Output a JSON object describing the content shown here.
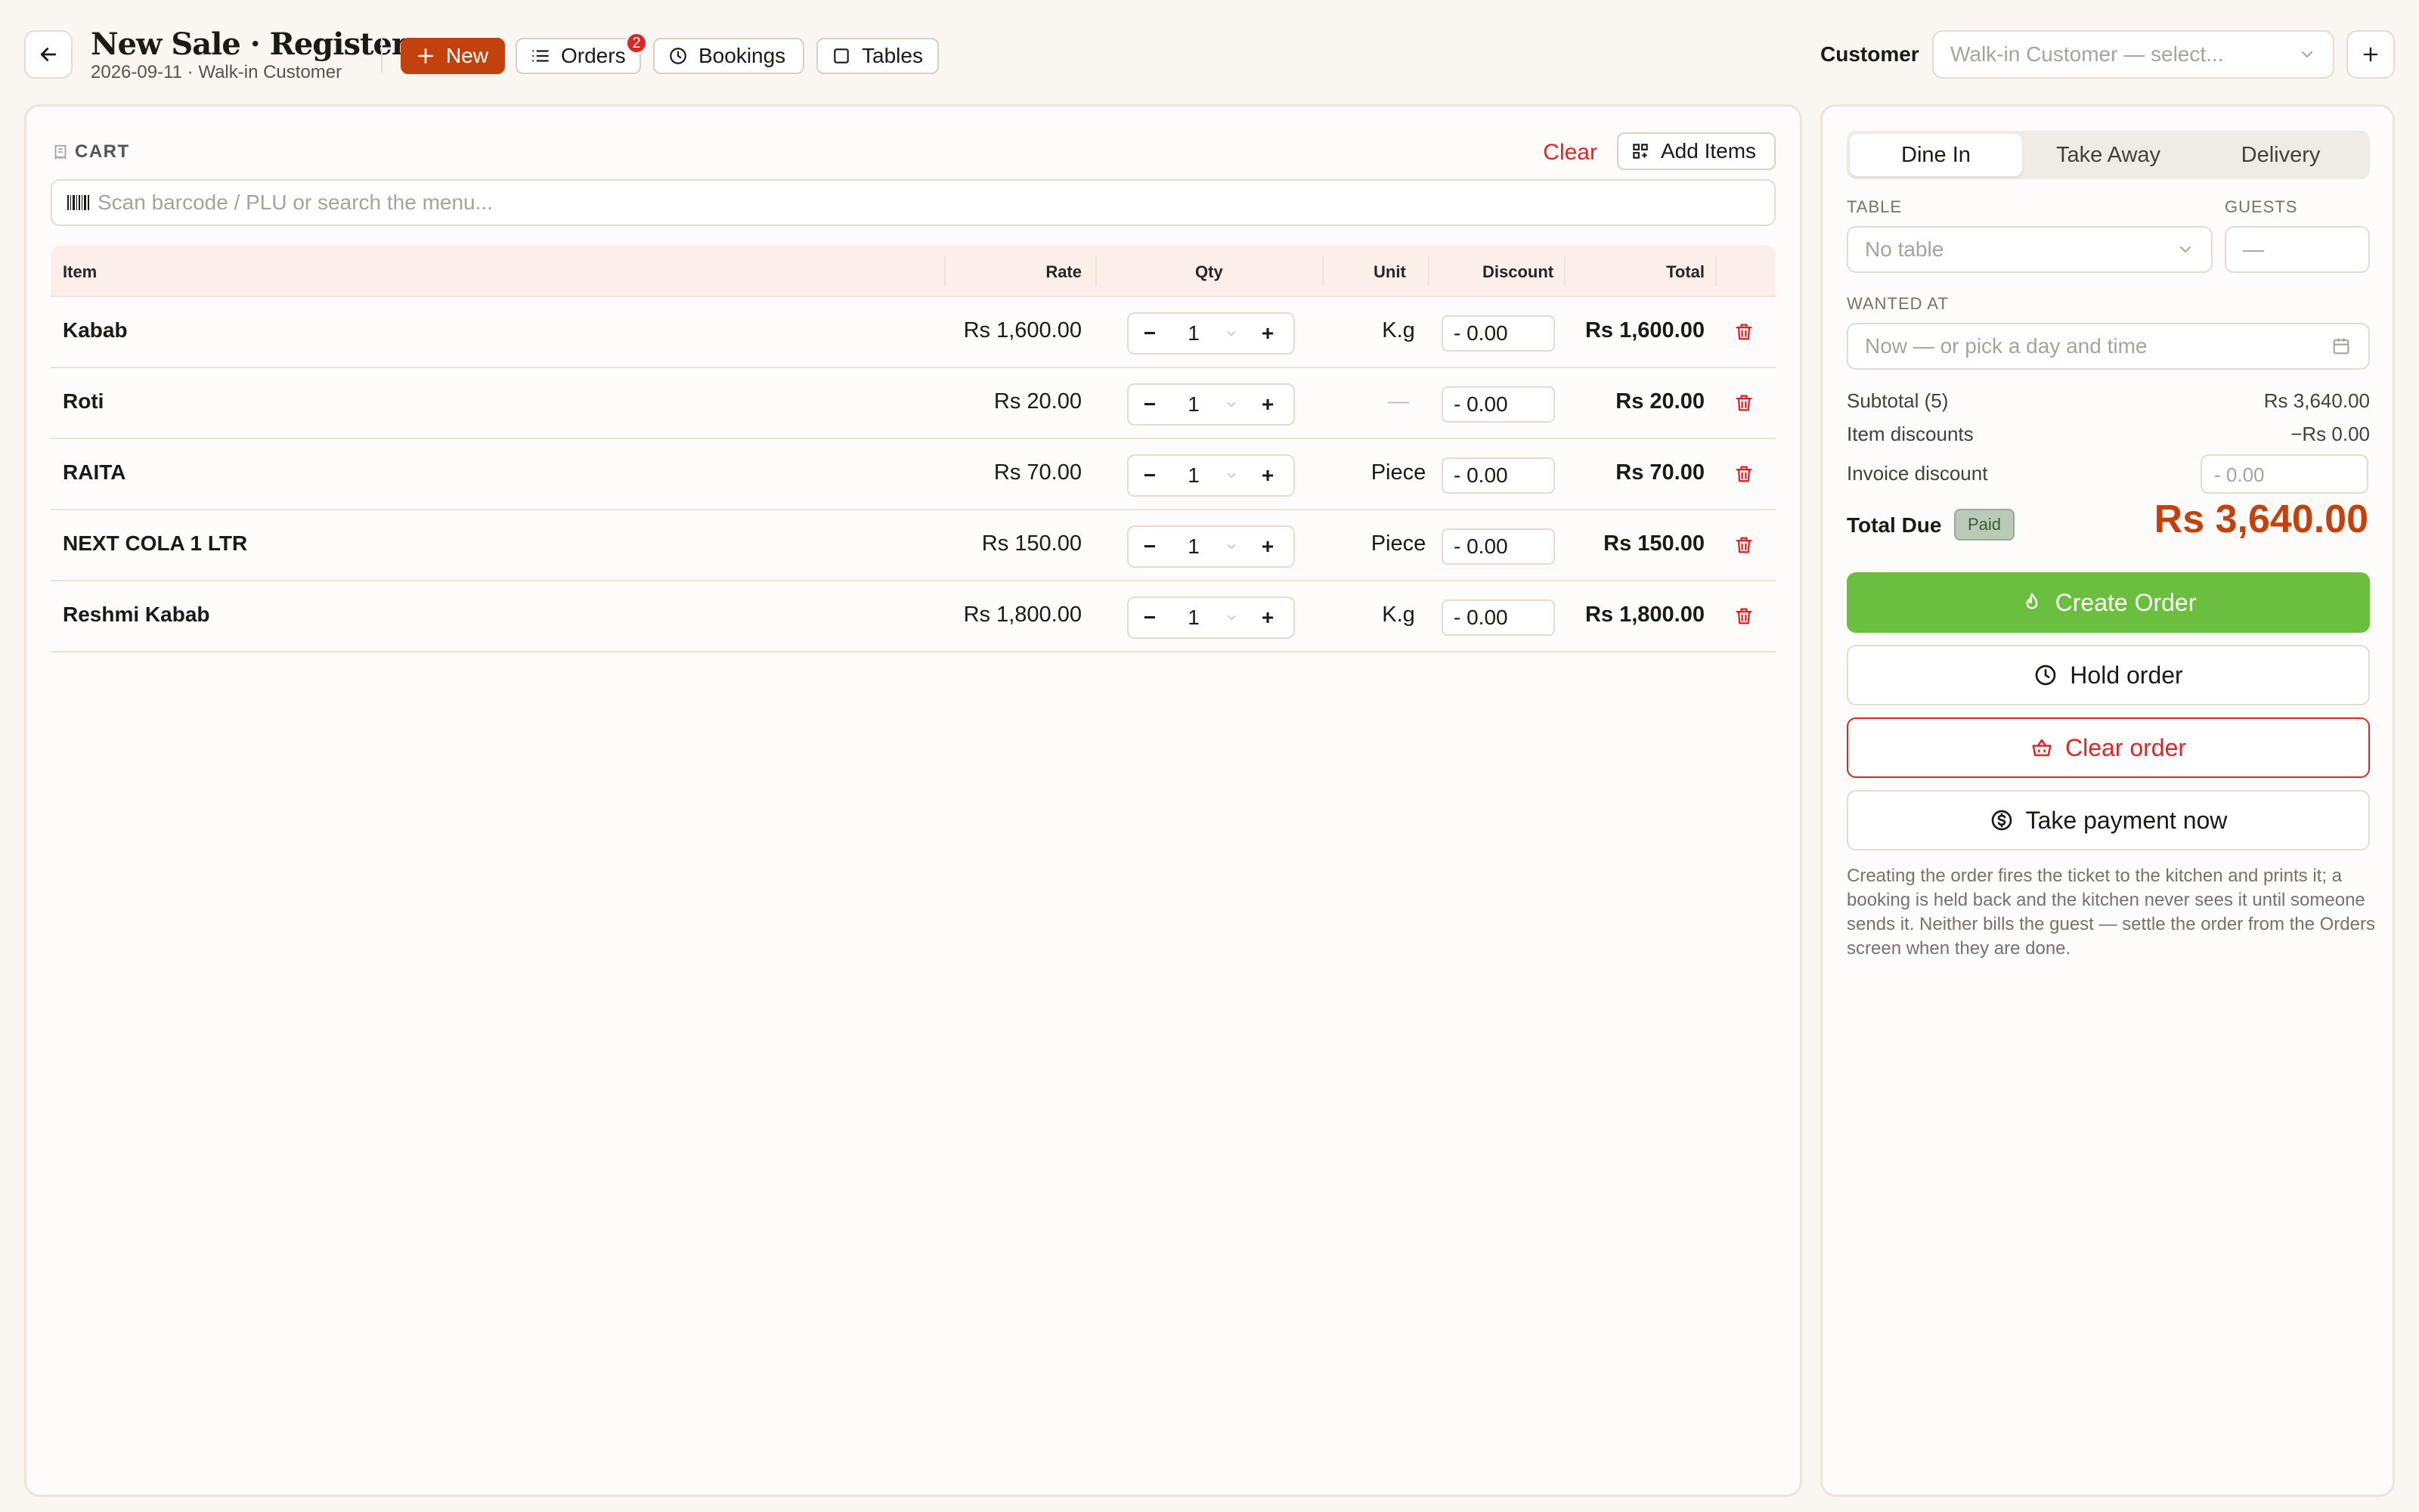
{
  "header": {
    "title": "New Sale · Register",
    "subtitle": "2026-09-11 · Walk-in Customer",
    "buttons": {
      "new": "New",
      "orders": "Orders",
      "orders_badge": "2",
      "bookings": "Bookings",
      "tables": "Tables"
    },
    "customer_label": "Customer",
    "customer_placeholder": "Walk-in Customer — select..."
  },
  "cart": {
    "title": "CART",
    "clear_label": "Clear",
    "add_items_label": "Add Items",
    "search_placeholder": "Scan barcode / PLU or search the menu...",
    "columns": [
      "Item",
      "Rate",
      "Qty",
      "Unit",
      "Discount",
      "Total"
    ],
    "rows": [
      {
        "item": "Kabab",
        "rate": "Rs 1,600.00",
        "qty": "1",
        "unit": "K.g",
        "discount": "- 0.00",
        "total": "Rs 1,600.00"
      },
      {
        "item": "Roti",
        "rate": "Rs 20.00",
        "qty": "1",
        "unit": "—",
        "discount": "- 0.00",
        "total": "Rs 20.00"
      },
      {
        "item": "RAITA",
        "rate": "Rs 70.00",
        "qty": "1",
        "unit": "Piece",
        "discount": "- 0.00",
        "total": "Rs 70.00"
      },
      {
        "item": "NEXT COLA 1 LTR",
        "rate": "Rs 150.00",
        "qty": "1",
        "unit": "Piece",
        "discount": "- 0.00",
        "total": "Rs 150.00"
      },
      {
        "item": "Reshmi Kabab",
        "rate": "Rs 1,800.00",
        "qty": "1",
        "unit": "K.g",
        "discount": "- 0.00",
        "total": "Rs 1,800.00"
      }
    ]
  },
  "order": {
    "tabs": [
      "Dine In",
      "Take Away",
      "Delivery"
    ],
    "active_tab": "Dine In",
    "table_label": "TABLE",
    "table_placeholder": "No table",
    "guests_label": "GUESTS",
    "guests_placeholder": "—",
    "wanted_label": "WANTED AT",
    "wanted_placeholder": "Now — or pick a day and time",
    "subtotal_label": "Subtotal (5)",
    "subtotal_value": "Rs 3,640.00",
    "item_discounts_label": "Item discounts",
    "item_discounts_value": "−Rs 0.00",
    "invoice_discount_label": "Invoice discount",
    "invoice_discount_value": "- 0.00",
    "total_label": "Total Due",
    "paid_badge": "Paid",
    "total_value": "Rs 3,640.00",
    "create_label": "Create Order",
    "hold_label": "Hold order",
    "clear_label": "Clear order",
    "pay_label": "Take payment now",
    "help_text": "Creating the order fires the ticket to the kitchen and prints it; a booking is held back and the kitchen never sees it until someone sends it. Neither bills the guest — settle the order from the Orders screen when they are done."
  },
  "colors": {
    "accent": "#c2410c",
    "create": "#6abf3f",
    "danger": "#dc2626",
    "paid": "#b9cbb6"
  }
}
